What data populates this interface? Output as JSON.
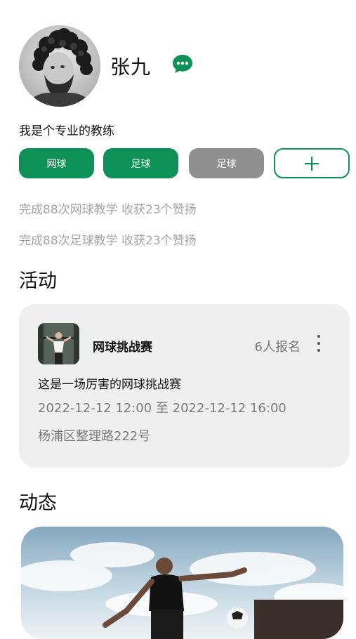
{
  "profile": {
    "name": "张九",
    "bio": "我是个专业的教练",
    "avatar_icon": "avatar-photo",
    "chat_icon": "chat-bubble-icon"
  },
  "tags": [
    {
      "label": "网球",
      "state": "active",
      "color": "#0d9156"
    },
    {
      "label": "足球",
      "state": "active",
      "color": "#0d9156"
    },
    {
      "label": "足球",
      "state": "inactive",
      "color": "#8f8f8f"
    }
  ],
  "add_tag_icon": "plus-icon",
  "stats": [
    "完成88次网球教学 收获23个赞扬",
    "完成88次足球教学 收获23个赞扬"
  ],
  "sections": {
    "activity_title": "活动",
    "feed_title": "动态"
  },
  "activity": {
    "title": "网球挑战赛",
    "signup_count": "6人报名",
    "description": "这是一场厉害的网球挑战赛",
    "time": "2022-12-12 12:00 至 2022-12-12 16:00",
    "address": "杨浦区整理路222号",
    "more_icon": "more-vertical-icon"
  },
  "colors": {
    "accent": "#0d9156",
    "muted_tag": "#8f8f8f",
    "card_bg": "#efefef",
    "stat_text": "#a6a6a6"
  }
}
